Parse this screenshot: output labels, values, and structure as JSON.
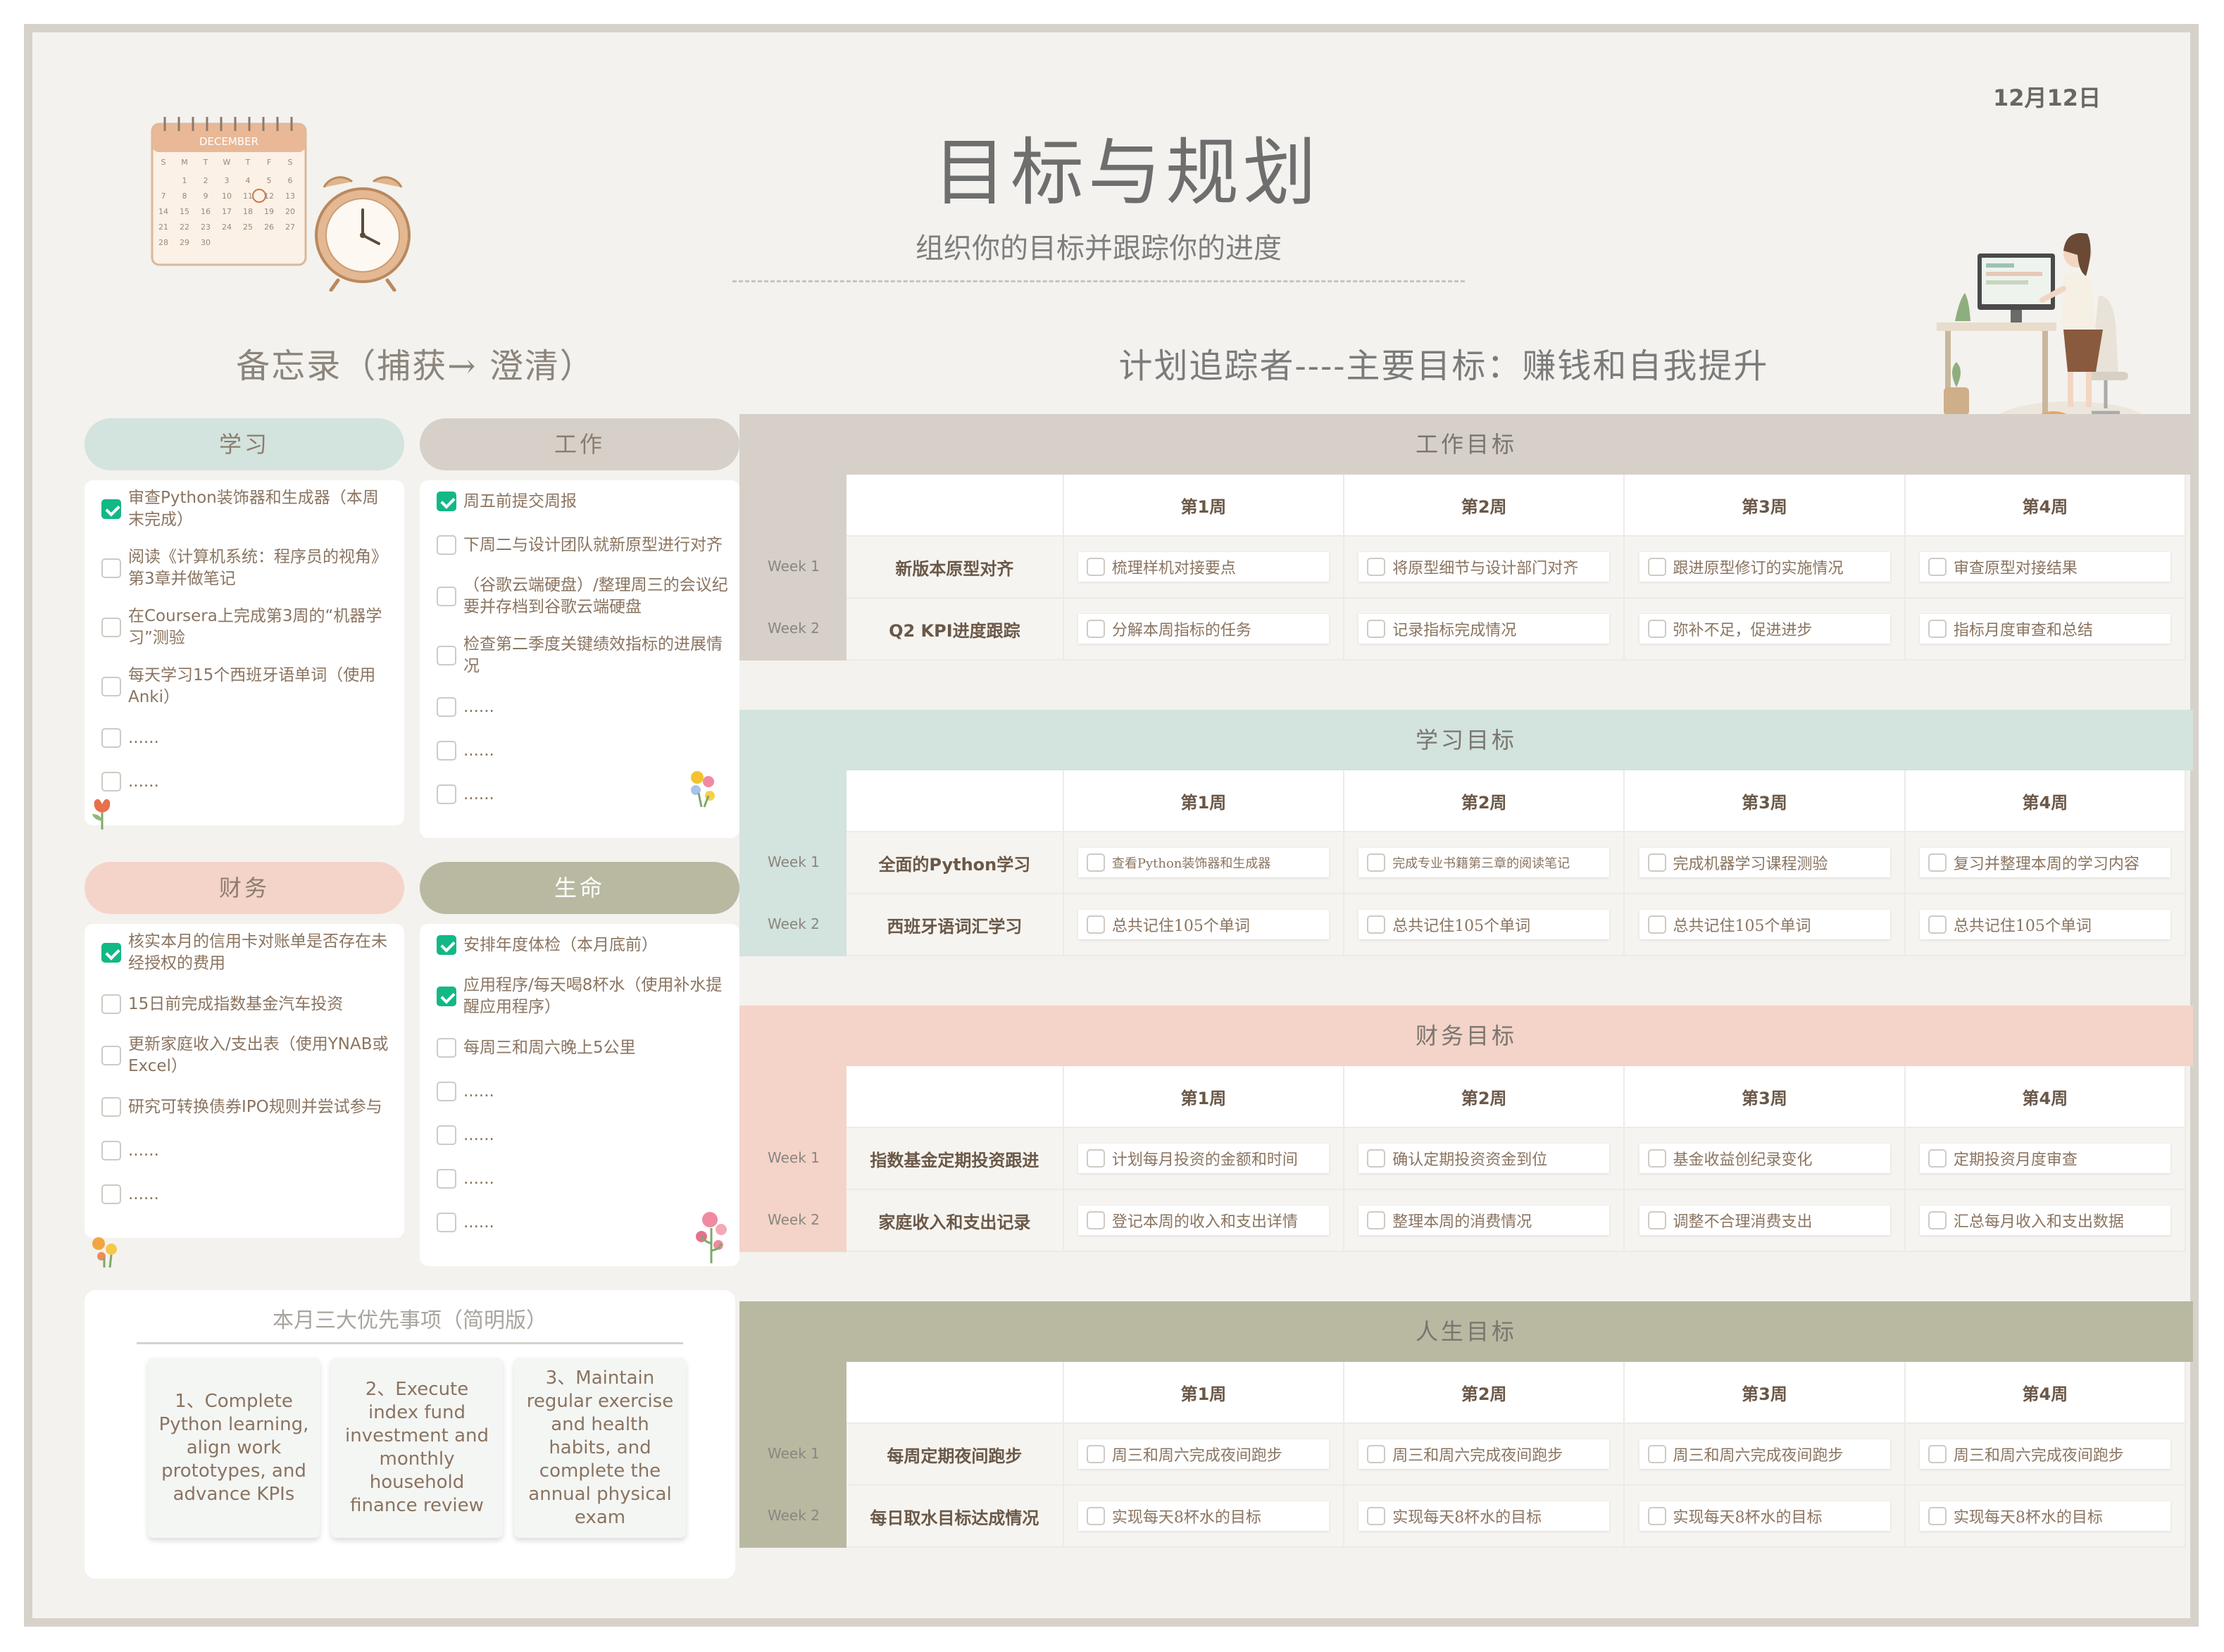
{
  "header": {
    "date": "12月12日",
    "title": "目标与规划",
    "subtitle": "组织你的目标并跟踪你的进度",
    "memo_title": "备忘录（捕获→ 澄清）",
    "plan_title": "计划追踪者----主要目标：赚钱和自我提升",
    "calendar_month": "DECEMBER"
  },
  "colors": {
    "study": "#d3e3dd",
    "work": "#d7d0c8",
    "finance": "#f4d4c8",
    "life": "#b9b9a2",
    "checkbox_checked": "#12b886"
  },
  "memo": {
    "study": {
      "title": "学习",
      "items": [
        {
          "text": "审查Python装饰器和生成器（本周末完成）",
          "checked": true
        },
        {
          "text": "阅读《计算机系统：程序员的视角》第3章并做笔记",
          "checked": false
        },
        {
          "text": "在Coursera上完成第3周的“机器学习”测验",
          "checked": false
        },
        {
          "text": "每天学习15个西班牙语单词（使用Anki）",
          "checked": false
        },
        {
          "text": "......",
          "checked": false
        },
        {
          "text": "......",
          "checked": false
        }
      ]
    },
    "work": {
      "title": "工作",
      "items": [
        {
          "text": "周五前提交周报",
          "checked": true
        },
        {
          "text": "下周二与设计团队就新原型进行对齐",
          "checked": false
        },
        {
          "text": "（谷歌云端硬盘）/整理周三的会议纪要并存档到谷歌云端硬盘",
          "checked": false
        },
        {
          "text": "检查第二季度关键绩效指标的进展情况",
          "checked": false
        },
        {
          "text": "......",
          "checked": false
        },
        {
          "text": "......",
          "checked": false
        },
        {
          "text": "......",
          "checked": false
        }
      ]
    },
    "finance": {
      "title": "财务",
      "items": [
        {
          "text": "核实本月的信用卡对账单是否存在未经授权的费用",
          "checked": true
        },
        {
          "text": "15日前完成指数基金汽车投资",
          "checked": false
        },
        {
          "text": "更新家庭收入/支出表（使用YNAB或Excel）",
          "checked": false
        },
        {
          "text": "研究可转换债券IPO规则并尝试参与",
          "checked": false
        },
        {
          "text": "......",
          "checked": false
        },
        {
          "text": "......",
          "checked": false
        }
      ]
    },
    "life": {
      "title": "生命",
      "items": [
        {
          "text": "安排年度体检（本月底前）",
          "checked": true
        },
        {
          "text": "应用程序/每天喝8杯水（使用补水提醒应用程序）",
          "checked": true
        },
        {
          "text": "每周三和周六晚上5公里",
          "checked": false
        },
        {
          "text": "......",
          "checked": false
        },
        {
          "text": "......",
          "checked": false
        },
        {
          "text": "......",
          "checked": false
        },
        {
          "text": "......",
          "checked": false
        }
      ]
    }
  },
  "priorities": {
    "title": "本月三大优先事项（简明版）",
    "items": [
      "1、Complete Python learning, align work prototypes, and advance KPIs",
      "2、Execute index fund investment and monthly household finance review",
      "3、Maintain regular exercise and health habits, and complete the annual physical exam"
    ]
  },
  "goals": {
    "week_headers": [
      "第1周",
      "第2周",
      "第3周",
      "第4周"
    ],
    "work": {
      "title": "工作目标",
      "rows": [
        {
          "week": "Week 1",
          "label": "新版本原型对齐",
          "tasks": [
            "梳理样机对接要点",
            "将原型细节与设计部门对齐",
            "跟进原型修订的实施情况",
            "审查原型对接结果"
          ]
        },
        {
          "week": "Week 2",
          "label": "Q2 KPI进度跟踪",
          "tasks": [
            "分解本周指标的任务",
            "记录指标完成情况",
            "弥补不足，促进进步",
            "指标月度审查和总结"
          ]
        }
      ]
    },
    "study": {
      "title": "学习目标",
      "rows": [
        {
          "week": "Week 1",
          "label": "全面的Python学习",
          "tasks": [
            "查看Python装饰器和生成器",
            "完成专业书籍第三章的阅读笔记",
            "完成机器学习课程测验",
            "复习并整理本周的学习内容"
          ]
        },
        {
          "week": "Week 2",
          "label": "西班牙语词汇学习",
          "tasks": [
            "总共记住105个单词",
            "总共记住105个单词",
            "总共记住105个单词",
            "总共记住105个单词"
          ]
        }
      ]
    },
    "finance": {
      "title": "财务目标",
      "rows": [
        {
          "week": "Week 1",
          "label": "指数基金定期投资跟进",
          "tasks": [
            "计划每月投资的金额和时间",
            "确认定期投资资金到位",
            "基金收益创纪录变化",
            "定期投资月度审查"
          ]
        },
        {
          "week": "Week 2",
          "label": "家庭收入和支出记录",
          "tasks": [
            "登记本周的收入和支出详情",
            "整理本周的消费情况",
            "调整不合理消费支出",
            "汇总每月收入和支出数据"
          ]
        }
      ]
    },
    "life": {
      "title": "人生目标",
      "rows": [
        {
          "week": "Week 1",
          "label": "每周定期夜间跑步",
          "tasks": [
            "周三和周六完成夜间跑步",
            "周三和周六完成夜间跑步",
            "周三和周六完成夜间跑步",
            "周三和周六完成夜间跑步"
          ]
        },
        {
          "week": "Week 2",
          "label": "每日取水目标达成情况",
          "tasks": [
            "实现每天8杯水的目标",
            "实现每天8杯水的目标",
            "实现每天8杯水的目标",
            "实现每天8杯水的目标"
          ]
        }
      ]
    }
  }
}
